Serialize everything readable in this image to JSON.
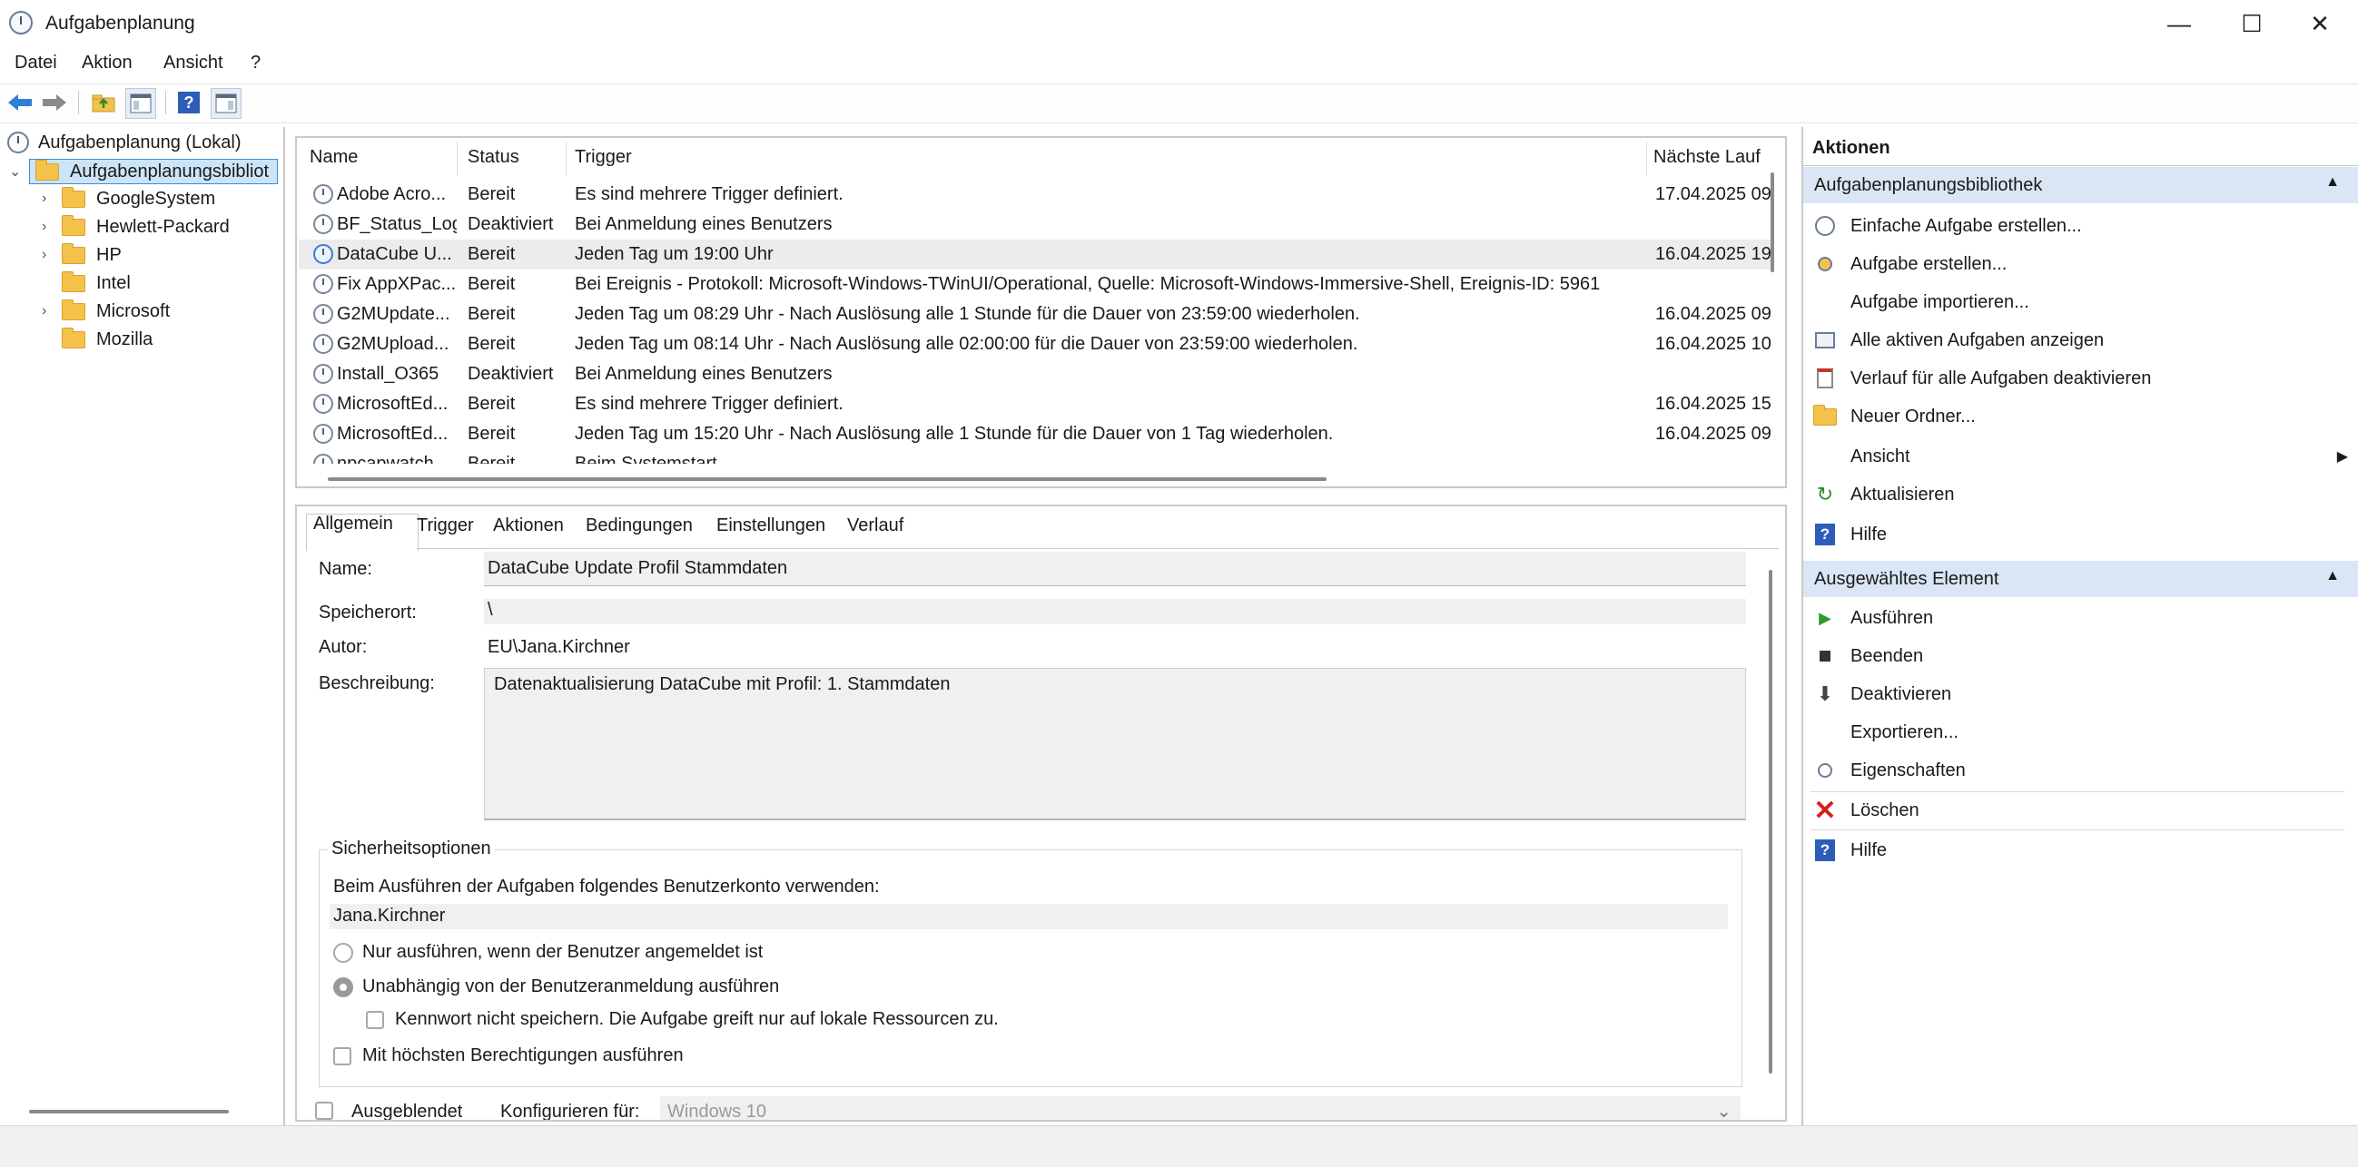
{
  "window": {
    "title": "Aufgabenplanung",
    "minimize": "—",
    "maximize": "☐",
    "close": "✕"
  },
  "menu": [
    "Datei",
    "Aktion",
    "Ansicht",
    "?"
  ],
  "toolbar": {
    "help_glyph": "?"
  },
  "tree": {
    "root": "Aufgabenplanung (Lokal)",
    "library": "Aufgabenplanungsbibliothek",
    "library_visible": "Aufgabenplanungsbibliot",
    "folders": [
      "GoogleSystem",
      "Hewlett-Packard",
      "HP",
      "Intel",
      "Microsoft",
      "Mozilla"
    ]
  },
  "tasks": {
    "columns": [
      "Name",
      "Status",
      "Trigger",
      "Nächste Lauf"
    ],
    "rows": [
      {
        "name": "Adobe Acro...",
        "status": "Bereit",
        "trigger": "Es sind mehrere Trigger definiert.",
        "next": "17.04.2025 09"
      },
      {
        "name": "BF_Status_Log",
        "status": "Deaktiviert",
        "trigger": "Bei Anmeldung eines Benutzers",
        "next": ""
      },
      {
        "name": "DataCube U...",
        "status": "Bereit",
        "trigger": "Jeden Tag um 19:00 Uhr",
        "next": "16.04.2025 19"
      },
      {
        "name": "Fix AppXPac...",
        "status": "Bereit",
        "trigger": "Bei Ereignis - Protokoll: Microsoft-Windows-TWinUI/Operational, Quelle: Microsoft-Windows-Immersive-Shell, Ereignis-ID: 5961",
        "next": ""
      },
      {
        "name": "G2MUpdate...",
        "status": "Bereit",
        "trigger": "Jeden Tag um 08:29 Uhr - Nach Auslösung alle 1 Stunde für die Dauer von 23:59:00 wiederholen.",
        "next": "16.04.2025 09"
      },
      {
        "name": "G2MUpload...",
        "status": "Bereit",
        "trigger": "Jeden Tag um 08:14 Uhr - Nach Auslösung alle 02:00:00 für die Dauer von 23:59:00 wiederholen.",
        "next": "16.04.2025 10"
      },
      {
        "name": "Install_O365",
        "status": "Deaktiviert",
        "trigger": "Bei Anmeldung eines Benutzers",
        "next": ""
      },
      {
        "name": "MicrosoftEd...",
        "status": "Bereit",
        "trigger": "Es sind mehrere Trigger definiert.",
        "next": "16.04.2025 15"
      },
      {
        "name": "MicrosoftEd...",
        "status": "Bereit",
        "trigger": "Jeden Tag um 15:20 Uhr - Nach Auslösung alle 1 Stunde für die Dauer von 1 Tag wiederholen.",
        "next": "16.04.2025 09"
      },
      {
        "name": "npcapwatch...",
        "status": "Bereit",
        "trigger": "Beim Systemstart",
        "next": ""
      }
    ]
  },
  "details": {
    "tabs": [
      "Allgemein",
      "Trigger",
      "Aktionen",
      "Bedingungen",
      "Einstellungen",
      "Verlauf"
    ],
    "name_label": "Name:",
    "name_value": "DataCube Update Profil Stammdaten",
    "location_label": "Speicherort:",
    "location_value": "\\",
    "author_label": "Autor:",
    "author_value": "EU\\Jana.Kirchner",
    "description_label": "Beschreibung:",
    "description_value": "Datenaktualisierung DataCube mit Profil: 1. Stammdaten",
    "security_title": "Sicherheitsoptionen",
    "security_prompt": "Beim Ausführen der Aufgaben folgendes Benutzerkonto verwenden:",
    "security_user": "Jana.Kirchner",
    "radio_logged_on": "Nur ausführen, wenn der Benutzer angemeldet ist",
    "radio_independent": "Unabhängig von der Benutzeranmeldung ausführen",
    "check_no_password": "Kennwort nicht speichern. Die Aufgabe greift nur auf lokale Ressourcen zu.",
    "check_highest": "Mit höchsten Berechtigungen ausführen",
    "hidden_label": "Ausgeblendet",
    "configure_label": "Konfigurieren für:",
    "configure_value": "Windows 10"
  },
  "actions": {
    "title": "Aktionen",
    "section1": "Aufgabenplanungsbibliothek",
    "items1": [
      "Einfache Aufgabe erstellen...",
      "Aufgabe erstellen...",
      "Aufgabe importieren...",
      "Alle aktiven Aufgaben anzeigen",
      "Verlauf für alle Aufgaben deaktivieren",
      "Neuer Ordner...",
      "Ansicht",
      "Aktualisieren",
      "Hilfe"
    ],
    "section2": "Ausgewähltes Element",
    "items2": [
      "Ausführen",
      "Beenden",
      "Deaktivieren",
      "Exportieren...",
      "Eigenschaften",
      "Löschen",
      "Hilfe"
    ]
  }
}
